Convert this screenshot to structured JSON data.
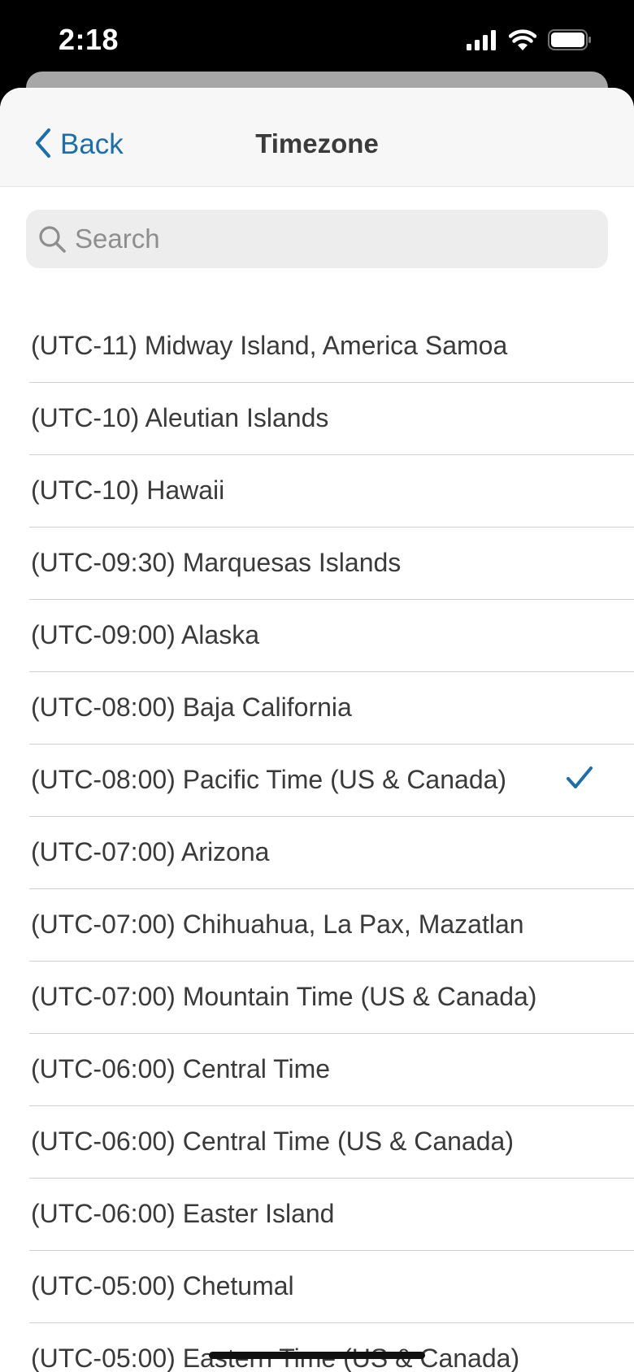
{
  "status_bar": {
    "time": "2:18",
    "icons": [
      "signal-icon",
      "wifi-icon",
      "battery-icon"
    ]
  },
  "nav": {
    "back_label": "Back",
    "title": "Timezone"
  },
  "search": {
    "placeholder": "Search",
    "value": ""
  },
  "colors": {
    "accent": "#1f6ea8",
    "text": "#3a3a3a",
    "separator": "#cfcfcf",
    "nav_bg": "#f7f7f7",
    "search_bg": "#ededed"
  },
  "timezones": [
    {
      "label": "(UTC-11) Midway Island, America Samoa",
      "selected": false
    },
    {
      "label": "(UTC-10) Aleutian Islands",
      "selected": false
    },
    {
      "label": "(UTC-10) Hawaii",
      "selected": false
    },
    {
      "label": "(UTC-09:30) Marquesas Islands",
      "selected": false
    },
    {
      "label": "(UTC-09:00) Alaska",
      "selected": false
    },
    {
      "label": "(UTC-08:00) Baja California",
      "selected": false
    },
    {
      "label": "(UTC-08:00) Pacific Time (US & Canada)",
      "selected": true
    },
    {
      "label": "(UTC-07:00) Arizona",
      "selected": false
    },
    {
      "label": "(UTC-07:00) Chihuahua, La Pax, Mazatlan",
      "selected": false
    },
    {
      "label": "(UTC-07:00) Mountain Time (US & Canada)",
      "selected": false
    },
    {
      "label": "(UTC-06:00) Central Time",
      "selected": false
    },
    {
      "label": "(UTC-06:00) Central Time (US & Canada)",
      "selected": false
    },
    {
      "label": "(UTC-06:00) Easter Island",
      "selected": false
    },
    {
      "label": "(UTC-05:00) Chetumal",
      "selected": false
    },
    {
      "label": "(UTC-05:00) Eastern Time (US & Canada)",
      "selected": false
    }
  ]
}
